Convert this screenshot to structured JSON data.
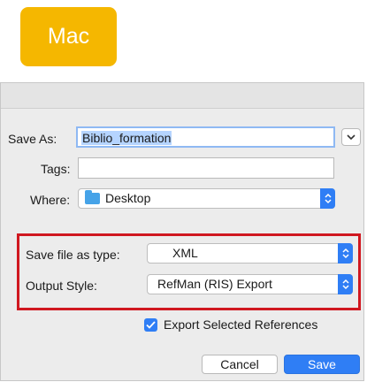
{
  "badge": {
    "label": "Mac"
  },
  "dialog": {
    "save_as": {
      "label": "Save As:",
      "value": "Biblio_formation"
    },
    "tags": {
      "label": "Tags:",
      "value": ""
    },
    "where": {
      "label": "Where:",
      "value": "Desktop"
    },
    "file_type": {
      "label": "Save file as type:",
      "value": "XML"
    },
    "output_style": {
      "label": "Output Style:",
      "value": "RefMan (RIS) Export"
    },
    "export_selected": {
      "label": "Export Selected References",
      "checked": true
    },
    "buttons": {
      "cancel": "Cancel",
      "save": "Save"
    }
  },
  "colors": {
    "badge": "#f5b700",
    "accent": "#2f7ef5",
    "highlight_border": "#d01820",
    "selection": "#b5d4ff"
  },
  "icons": [
    "chevron-down-icon",
    "popup-arrows-icon",
    "folder-icon",
    "checkmark-icon"
  ]
}
